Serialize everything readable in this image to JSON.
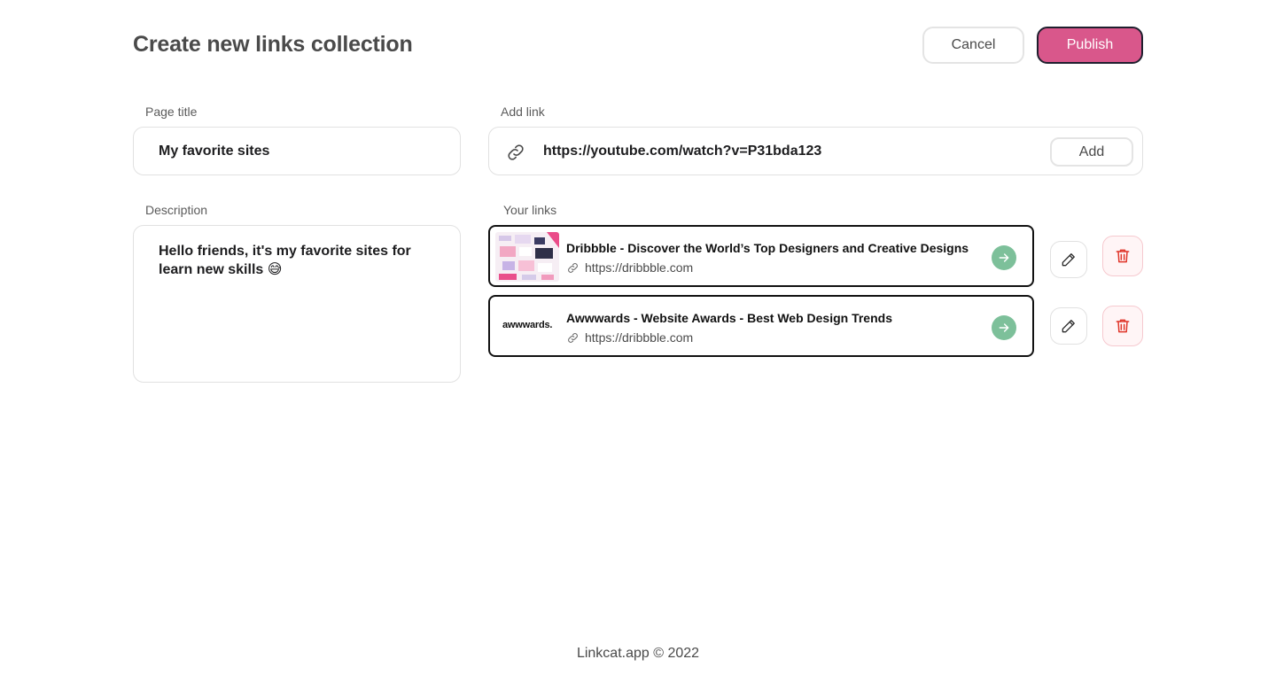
{
  "header": {
    "title": "Create new links collection",
    "cancel_label": "Cancel",
    "publish_label": "Publish"
  },
  "form": {
    "page_title_label": "Page title",
    "page_title_value": "My favorite sites",
    "description_label": "Description",
    "description_value": "Hello friends, it's my favorite sites for learn new skills 😅",
    "add_link_label": "Add link",
    "add_link_value": "https://youtube.com/watch?v=P31bda123",
    "add_button_label": "Add"
  },
  "links": {
    "section_label": "Your links",
    "items": [
      {
        "title": "Dribbble - Discover the World’s Top Designers and Creative Designs",
        "url": "https://dribbble.com",
        "thumbnail": "dribbble-preview"
      },
      {
        "title": "Awwwards - Website Awards - Best Web Design Trends",
        "url": "https://dribbble.com",
        "thumbnail": "awwwards.",
        "thumbnail_text": "awwwards."
      }
    ]
  },
  "icons": {
    "link": "link-icon",
    "go": "arrow-right-icon",
    "edit": "pencil-icon",
    "delete": "trash-icon"
  },
  "colors": {
    "accent": "#d9578b",
    "go_button": "#7dc09a",
    "delete": "#e0362a"
  },
  "footer": {
    "text": "Linkcat.app © 2022"
  }
}
